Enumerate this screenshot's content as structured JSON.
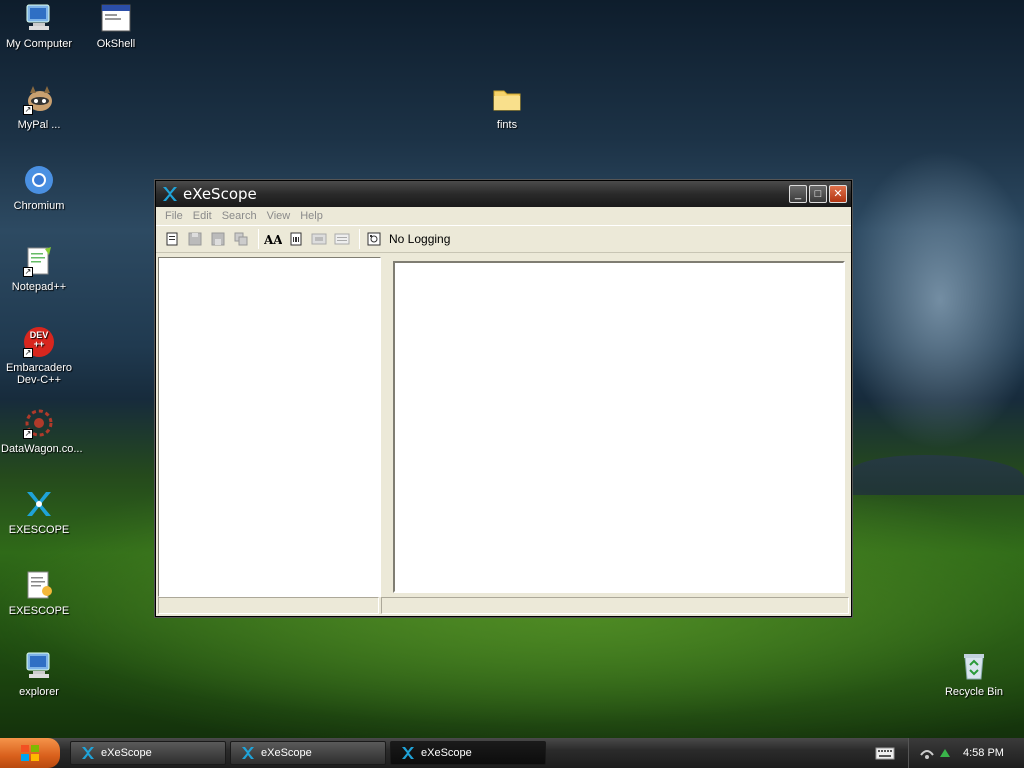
{
  "desktop": {
    "icons": [
      {
        "label": "My Computer",
        "icon": "computer-icon"
      },
      {
        "label": "OkShell",
        "icon": "window-icon"
      },
      {
        "label": "MyPal ...",
        "icon": "raccoon-icon"
      },
      {
        "label": "fints",
        "icon": "folder-icon"
      },
      {
        "label": "Chromium",
        "icon": "chromium-icon"
      },
      {
        "label": "Notepad++",
        "icon": "notepad-icon"
      },
      {
        "label": "Embarcadero Dev-C++",
        "icon": "devcpp-icon",
        "badge": "DEV\n++"
      },
      {
        "label": "DataWagon.co...",
        "icon": "datawagon-icon"
      },
      {
        "label": "EXESCOPE",
        "icon": "exescope-icon"
      },
      {
        "label": "EXESCOPE",
        "icon": "text-file-icon"
      },
      {
        "label": "explorer",
        "icon": "computer-icon"
      },
      {
        "label": "Recycle Bin",
        "icon": "recycle-bin-icon"
      }
    ]
  },
  "window": {
    "title": "eXeScope",
    "menu": [
      "File",
      "Edit",
      "Search",
      "View",
      "Help"
    ],
    "toolbar": {
      "logging_label": "No Logging"
    }
  },
  "taskbar": {
    "tasks": [
      {
        "label": "eXeScope",
        "active": false
      },
      {
        "label": "eXeScope",
        "active": false
      },
      {
        "label": "eXeScope",
        "active": true
      }
    ],
    "clock": "4:58 PM"
  },
  "colors": {
    "titlebar": "#2a2a2a",
    "start_button": "#d9601c",
    "window_face": "#ece9d8"
  }
}
